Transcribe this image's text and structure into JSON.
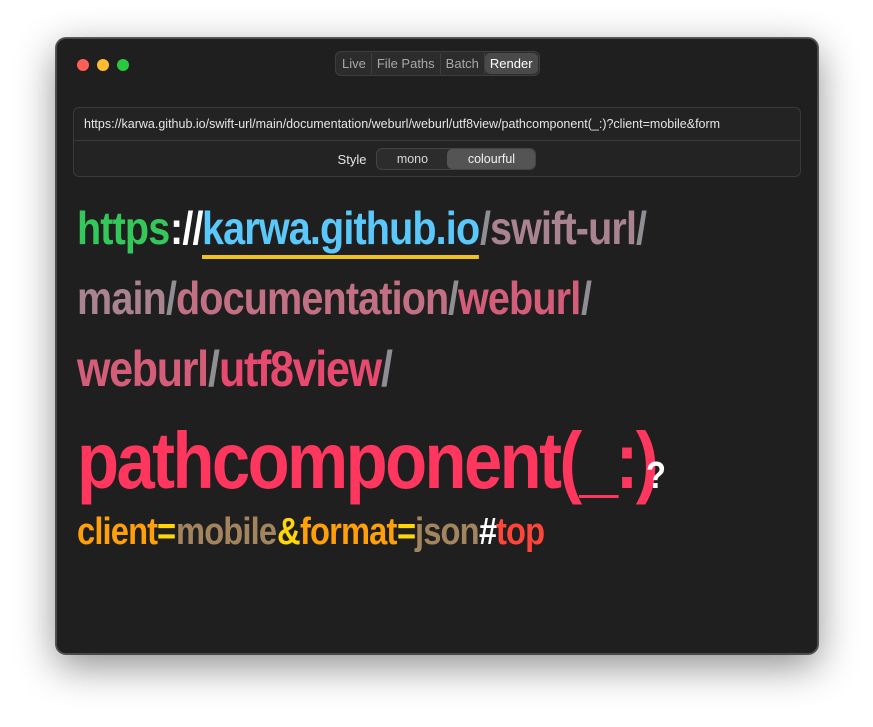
{
  "window": {
    "tabs": [
      "Live",
      "File Paths",
      "Batch",
      "Render"
    ],
    "active_tab": "Render"
  },
  "url_field": {
    "value": "https://karwa.github.io/swift-url/main/documentation/weburl/weburl/utf8view/pathcomponent(_:)?client=mobile&form"
  },
  "style_control": {
    "label": "Style",
    "options": [
      "mono",
      "colourful"
    ],
    "selected": "colourful"
  },
  "rendered_url": {
    "line1": {
      "scheme": "https",
      "scheme_sep": "://",
      "host_part1": "karwa",
      "host_dot1": ".",
      "host_part2": "github",
      "host_dot2": ".",
      "host_part3": "io",
      "sep1": "/",
      "path1": "swift-url",
      "sep2": "/"
    },
    "line2": {
      "path2": "main",
      "sep3": "/",
      "path3": "documentation",
      "sep4": "/",
      "path4": "weburl",
      "sep5": "/"
    },
    "line3": {
      "path5": "weburl",
      "sep6": "/",
      "path6": "utf8view",
      "sep7": "/"
    },
    "line4": {
      "path7": "pathcomponent(_:)",
      "query_mark": "?"
    },
    "line5": {
      "key1": "client",
      "eq1": "=",
      "val1": "mobile",
      "amp": "&",
      "key2": "format",
      "eq2": "=",
      "val2": "json",
      "hash": "#",
      "fragment": "top"
    }
  },
  "colors": {
    "scheme": "#34c759",
    "host": "#5ac8fa",
    "host_underline": "#f0c020",
    "path_1": "#a9838f",
    "path_2": "#c27185",
    "path_3": "#d45e7a",
    "path_4": "#e84a6f",
    "path_5": "#ff375f",
    "query_key": "#ff9f0a",
    "query_eq": "#ffd60a",
    "query_val": "#a2845e",
    "fragment": "#ff453a",
    "separator": "#8e8e93"
  }
}
